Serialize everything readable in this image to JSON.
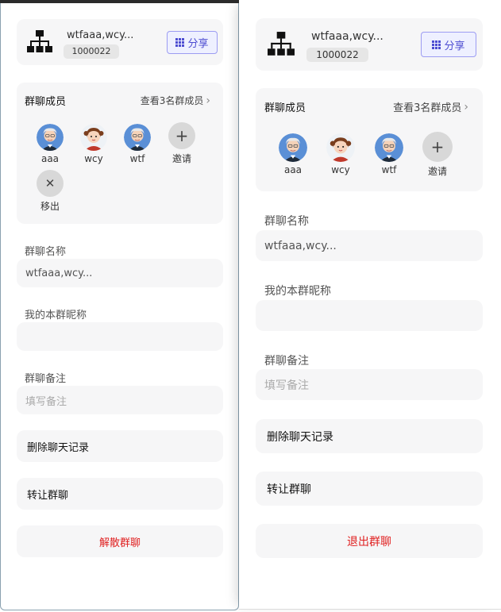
{
  "colors": {
    "accent": "#4d4dd1",
    "danger": "#e02020",
    "card": "#f6f6f7"
  },
  "left": {
    "group": {
      "name": "wtfaaa,wcy...",
      "id": "1000022",
      "icon": "org-chart-icon"
    },
    "share_label": "分享",
    "members": {
      "title": "群聊成员",
      "view_all": "查看3名群成员",
      "list": [
        {
          "name": "aaa",
          "avatar": "old-man"
        },
        {
          "name": "wcy",
          "avatar": "girl"
        },
        {
          "name": "wtf",
          "avatar": "old-man"
        }
      ],
      "invite_label": "邀请",
      "remove_label": "移出"
    },
    "fields": {
      "group_name_label": "群聊名称",
      "group_name_value": "wtfaaa,wcy...",
      "nickname_label": "我的本群昵称",
      "nickname_value": "",
      "remark_label": "群聊备注",
      "remark_placeholder": "填写备注"
    },
    "actions": {
      "clear_history": "删除聊天记录",
      "transfer": "转让群聊",
      "dismiss": "解散群聊"
    }
  },
  "right": {
    "group": {
      "name": "wtfaaa,wcy...",
      "id": "1000022",
      "icon": "org-chart-icon"
    },
    "share_label": "分享",
    "members": {
      "title": "群聊成员",
      "view_all": "查看3名群成员",
      "list": [
        {
          "name": "aaa",
          "avatar": "old-man"
        },
        {
          "name": "wcy",
          "avatar": "girl"
        },
        {
          "name": "wtf",
          "avatar": "old-man"
        }
      ],
      "invite_label": "邀请"
    },
    "fields": {
      "group_name_label": "群聊名称",
      "group_name_value": "wtfaaa,wcy...",
      "nickname_label": "我的本群昵称",
      "nickname_value": "",
      "remark_label": "群聊备注",
      "remark_placeholder": "填写备注"
    },
    "actions": {
      "clear_history": "删除聊天记录",
      "transfer": "转让群聊",
      "quit": "退出群聊"
    }
  }
}
